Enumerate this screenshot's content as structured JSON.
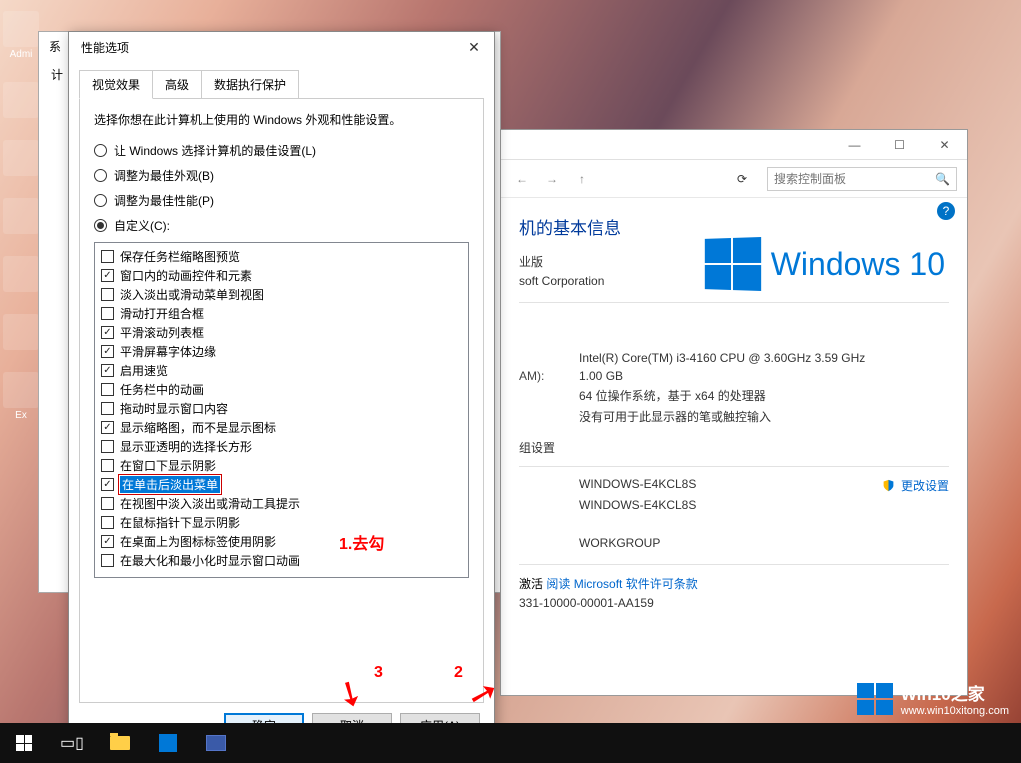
{
  "desktop_icons": {
    "admin": "Admi",
    "explorer": "Ex"
  },
  "syswin": {
    "title": "系",
    "tab": "计"
  },
  "cpwin": {
    "minimize": "—",
    "maximize": "☐",
    "close_label": "✕",
    "nav_back": "←",
    "nav_fwd": "→",
    "nav_up": "↑",
    "refresh": "⟳",
    "search_placeholder": "搜索控制面板",
    "search_icon": "🔍",
    "help": "?",
    "heading": "机的基本信息",
    "edition_suffix": "业版",
    "copyright_suffix": "soft Corporation",
    "logo_text": "Windows 10",
    "ram_label": "AM):",
    "processor": "Intel(R) Core(TM) i3-4160 CPU @ 3.60GHz   3.59 GHz",
    "ram": "1.00 GB",
    "systype": "64 位操作系统，基于 x64 的处理器",
    "touch": "没有可用于此显示器的笔或触控输入",
    "section2": "组设置",
    "computer_name": "WINDOWS-E4KCL8S",
    "full_name": "WINDOWS-E4KCL8S",
    "change_link": "更改设置",
    "workgroup": "WORKGROUP",
    "activate_prefix": "激活",
    "activate_link": "阅读 Microsoft 软件许可条款",
    "product_id": "331-10000-00001-AA159"
  },
  "perf": {
    "title": "性能选项",
    "close": "✕",
    "tabs": {
      "visual": "视觉效果",
      "advanced": "高级",
      "dep": "数据执行保护"
    },
    "intro": "选择你想在此计算机上使用的 Windows 外观和性能设置。",
    "radios": {
      "auto": "让 Windows 选择计算机的最佳设置(L)",
      "best_look": "调整为最佳外观(B)",
      "best_perf": "调整为最佳性能(P)",
      "custom": "自定义(C):"
    },
    "items": [
      {
        "checked": false,
        "label": "保存任务栏缩略图预览"
      },
      {
        "checked": true,
        "label": "窗口内的动画控件和元素"
      },
      {
        "checked": false,
        "label": "淡入淡出或滑动菜单到视图"
      },
      {
        "checked": false,
        "label": "滑动打开组合框"
      },
      {
        "checked": true,
        "label": "平滑滚动列表框"
      },
      {
        "checked": true,
        "label": "平滑屏幕字体边缘"
      },
      {
        "checked": true,
        "label": "启用速览"
      },
      {
        "checked": false,
        "label": "任务栏中的动画"
      },
      {
        "checked": false,
        "label": "拖动时显示窗口内容"
      },
      {
        "checked": true,
        "label": "显示缩略图，而不是显示图标"
      },
      {
        "checked": false,
        "label": "显示亚透明的选择长方形"
      },
      {
        "checked": false,
        "label": "在窗口下显示阴影"
      },
      {
        "checked": true,
        "label": "在单击后淡出菜单",
        "highlight": true
      },
      {
        "checked": false,
        "label": "在视图中淡入淡出或滑动工具提示"
      },
      {
        "checked": false,
        "label": "在鼠标指针下显示阴影"
      },
      {
        "checked": true,
        "label": "在桌面上为图标标签使用阴影"
      },
      {
        "checked": false,
        "label": "在最大化和最小化时显示窗口动画"
      }
    ],
    "annot1": "1.去勾",
    "annot2": "2",
    "annot3": "3",
    "ok": "确定",
    "cancel": "取消",
    "apply": "应用(A)"
  },
  "watermark": {
    "brand": "Win10之家",
    "url": "www.win10xitong.com"
  },
  "taskbar": {
    "taskview": "▭▯",
    "store": "⊞"
  }
}
